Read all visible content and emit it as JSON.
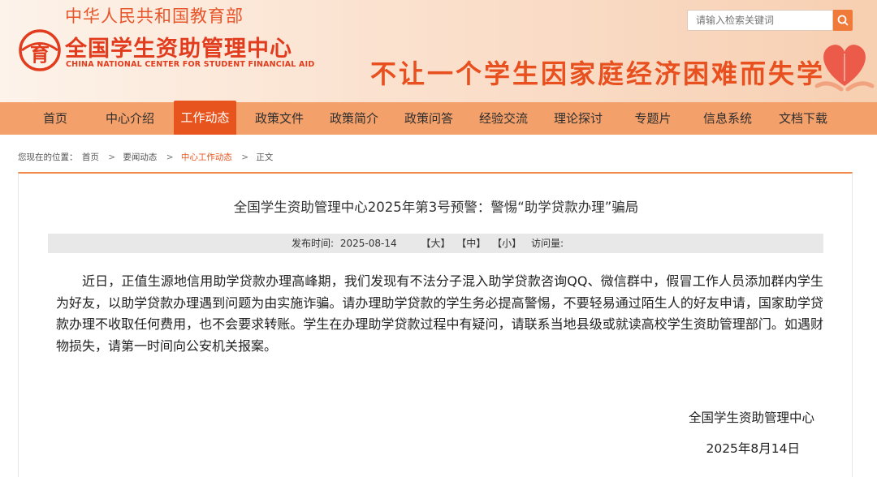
{
  "header": {
    "ministry": "中华人民共和国教育部",
    "center_name": "全国学生资助管理中心",
    "center_name_en": "CHINA NATIONAL CENTER FOR STUDENT FINANCIAL AID",
    "slogan": "不让一个学生因家庭经济困难而失学",
    "search_placeholder": "请输入检索关键词",
    "logo_char": "育"
  },
  "nav": {
    "items": [
      {
        "label": "首页"
      },
      {
        "label": "中心介绍"
      },
      {
        "label": "工作动态"
      },
      {
        "label": "政策文件"
      },
      {
        "label": "政策简介"
      },
      {
        "label": "政策问答"
      },
      {
        "label": "经验交流"
      },
      {
        "label": "理论探讨"
      },
      {
        "label": "专题片"
      },
      {
        "label": "信息系统"
      },
      {
        "label": "文档下载"
      }
    ],
    "active_index": 2
  },
  "breadcrumb": {
    "prefix": "您现在的位置：",
    "items": [
      "首页",
      "要闻动态",
      "中心工作动态",
      "正文"
    ],
    "separator": ">"
  },
  "article": {
    "title": "全国学生资助管理中心2025年第3号预警：警惕“助学贷款办理”骗局",
    "publish_label": "发布时间:",
    "publish_date": "2025-08-14",
    "size_large": "【大】",
    "size_medium": "【中】",
    "size_small": "【小】",
    "visits_label": "访问量:",
    "body": "近日，正值生源地信用助学贷款办理高峰期，我们发现有不法分子混入助学贷款咨询QQ、微信群中，假冒工作人员添加群内学生为好友，以助学贷款办理遇到问题为由实施诈骗。请办理助学贷款的学生务必提高警惕，不要轻易通过陌生人的好友申请，国家助学贷款办理不收取任何费用，也不会要求转账。学生在办理助学贷款过程中有疑问，请联系当地县级或就读高校学生资助管理部门。如遇财物损失，请第一时间向公安机关报案。",
    "sign_org": "全国学生资助管理中心",
    "sign_date": "2025年8月14日"
  },
  "colors": {
    "brand_red": "#e23c1e",
    "nav_bg": "#f4a06a",
    "nav_active": "#e8541d",
    "accent_orange": "#f08a4b"
  }
}
